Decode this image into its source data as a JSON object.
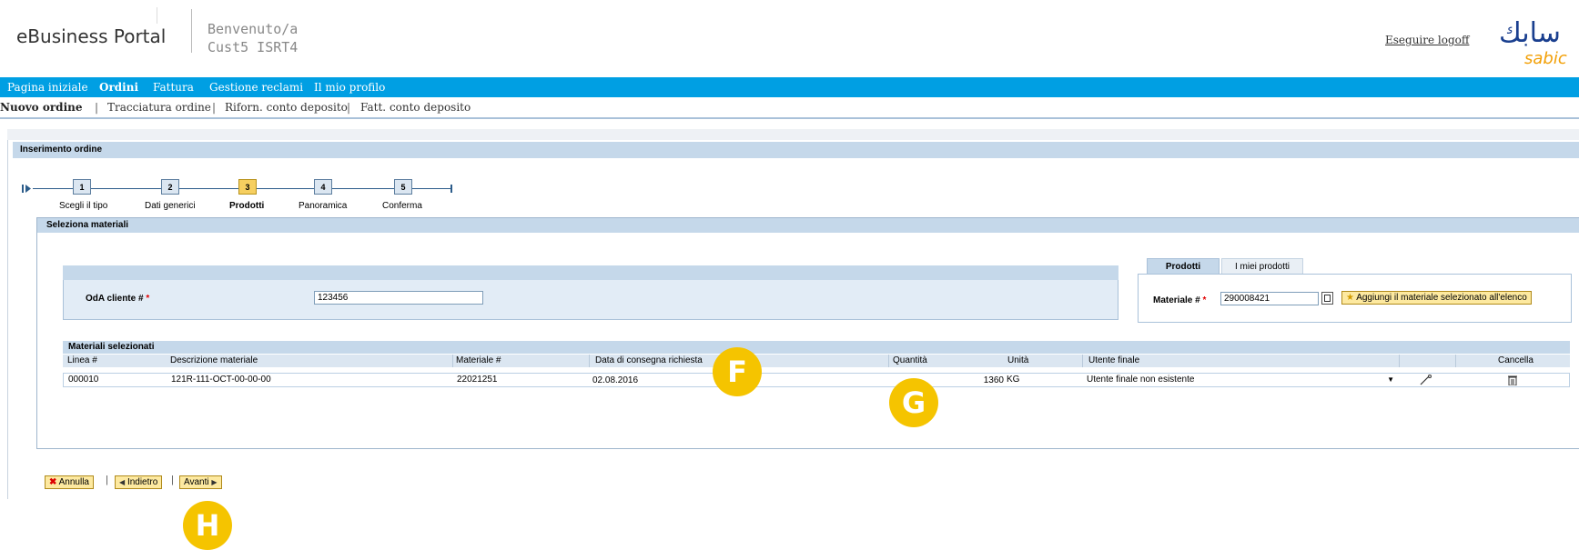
{
  "header": {
    "brand": "eBusiness Portal",
    "welcome_line1": "Benvenuto/a",
    "welcome_line2": "Cust5 ISRT4",
    "logoff": "Eseguire logoff",
    "logo_text": "sabic",
    "logo_arabic": "سابك"
  },
  "main_nav": [
    "Pagina iniziale",
    "Ordini",
    "Fattura",
    "Gestione reclami",
    "Il mio profilo"
  ],
  "sub_nav": [
    "Nuovo ordine",
    "Tracciatura ordine",
    "Riforn. conto deposito",
    "Fatt. conto deposito"
  ],
  "panel_title": "Inserimento ordine",
  "roadmap": [
    {
      "num": "1",
      "label": "Scegli il tipo"
    },
    {
      "num": "2",
      "label": "Dati generici"
    },
    {
      "num": "3",
      "label": "Prodotti"
    },
    {
      "num": "4",
      "label": "Panoramica"
    },
    {
      "num": "5",
      "label": "Conferma"
    }
  ],
  "inner_title": "Seleziona materiali",
  "oda": {
    "label": "OdA cliente #",
    "required": "*",
    "value": "123456"
  },
  "tabs": [
    "Prodotti",
    "I miei prodotti"
  ],
  "materiale": {
    "label": "Materiale #",
    "required": "*",
    "value": "290008421",
    "add_button": "Aggiungi il materiale selezionato all'elenco"
  },
  "table": {
    "title": "Materiali selezionati",
    "headers": [
      "Linea #",
      "Descrizione materiale",
      "Materiale #",
      "Data di consegna richiesta",
      "Quantità",
      "Unità",
      "Utente finale",
      "Cancella"
    ],
    "rows": [
      {
        "linea": "000010",
        "descrizione": "121R-111-OCT-00-00-00",
        "materiale": "22021251",
        "data": "02.08.2016",
        "quantita": "1360",
        "unita": "KG",
        "utente": "Utente finale non esistente"
      }
    ]
  },
  "badges": [
    "F",
    "G",
    "H"
  ],
  "buttons": {
    "annulla": "Annulla",
    "indietro": "Indietro",
    "avanti": "Avanti"
  },
  "colors": {
    "nav": "#009fe3",
    "header_band": "#c5d8ea",
    "badge": "#f5c400",
    "button": "#fde9a0"
  }
}
